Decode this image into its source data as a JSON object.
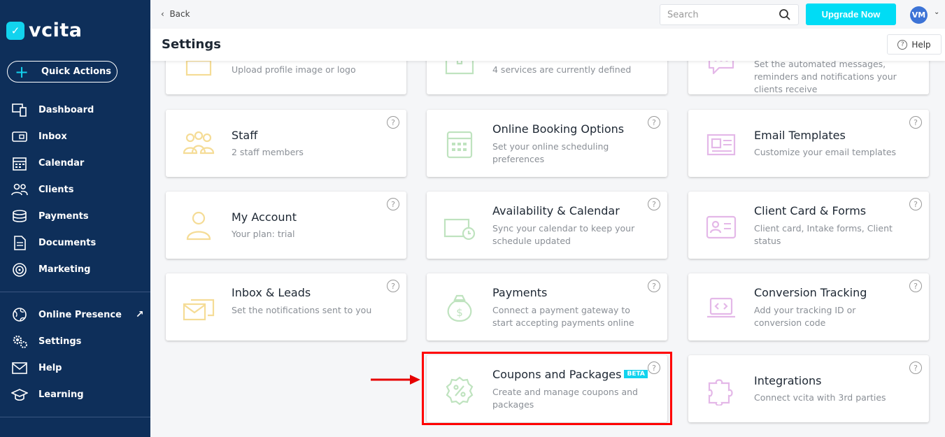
{
  "brand": {
    "name": "vcita",
    "accent": "#12d3ee",
    "sidebar_bg": "#0e2f5a"
  },
  "sidebar": {
    "quick_actions": "Quick Actions",
    "items": [
      {
        "label": "Dashboard",
        "icon": "dashboard-icon"
      },
      {
        "label": "Inbox",
        "icon": "inbox-icon"
      },
      {
        "label": "Calendar",
        "icon": "calendar-icon"
      },
      {
        "label": "Clients",
        "icon": "clients-icon"
      },
      {
        "label": "Payments",
        "icon": "payments-icon"
      },
      {
        "label": "Documents",
        "icon": "documents-icon"
      },
      {
        "label": "Marketing",
        "icon": "marketing-icon"
      }
    ],
    "secondary": [
      {
        "label": "Online Presence",
        "icon": "globe-icon"
      },
      {
        "label": "Settings",
        "icon": "settings-icon"
      },
      {
        "label": "Help",
        "icon": "mail-icon"
      },
      {
        "label": "Learning",
        "icon": "graduation-cap-icon"
      }
    ]
  },
  "topbar": {
    "back": "Back",
    "search_placeholder": "Search",
    "upgrade": "Upgrade Now",
    "avatar": "VM"
  },
  "header": {
    "title": "Settings",
    "help": "Help"
  },
  "cards": [
    {
      "title": "",
      "subtitle": "Upload profile image or logo",
      "icon": "storefront-icon",
      "color": "#f5dc96"
    },
    {
      "title": "",
      "subtitle": "4 services are currently defined",
      "icon": "briefcase-icon",
      "color": "#bfe3bf"
    },
    {
      "title": "",
      "subtitle": "Set the automated messages, reminders and notifications your clients receive",
      "icon": "chat-icon",
      "color": "#e4b8e8"
    },
    {
      "title": "Staff",
      "subtitle": "2 staff members",
      "icon": "staff-icon",
      "color": "#f5dc96"
    },
    {
      "title": "Online Booking Options",
      "subtitle": "Set your online scheduling preferences",
      "icon": "calendar-icon",
      "color": "#bfe3bf"
    },
    {
      "title": "Email Templates",
      "subtitle": "Customize your email templates",
      "icon": "newspaper-icon",
      "color": "#e4b8e8"
    },
    {
      "title": "My Account",
      "subtitle": "Your plan: trial",
      "icon": "user-icon",
      "color": "#f5dc96"
    },
    {
      "title": "Availability & Calendar",
      "subtitle": "Sync your calendar to keep your schedule updated",
      "icon": "briefcase-clock-icon",
      "color": "#bfe3bf"
    },
    {
      "title": "Client Card & Forms",
      "subtitle": "Client card, Intake forms, Client status",
      "icon": "id-card-icon",
      "color": "#e4b8e8"
    },
    {
      "title": "Inbox & Leads",
      "subtitle": "Set the notifications sent to you",
      "icon": "envelopes-icon",
      "color": "#f5dc96"
    },
    {
      "title": "Payments",
      "subtitle": "Connect a payment gateway to start accepting payments online",
      "icon": "money-bag-icon",
      "color": "#bfe3bf"
    },
    {
      "title": "Conversion Tracking",
      "subtitle": "Add your tracking ID or conversion code",
      "icon": "laptop-code-icon",
      "color": "#e4b8e8"
    },
    {
      "title": "Coupons and Packages",
      "subtitle": "Create and manage coupons and packages",
      "icon": "coupon-icon",
      "color": "#bfe3bf",
      "badge": "BETA"
    },
    {
      "title": "Integrations",
      "subtitle": "Connect vcita with 3rd parties",
      "icon": "puzzle-icon",
      "color": "#e4b8e8"
    }
  ]
}
